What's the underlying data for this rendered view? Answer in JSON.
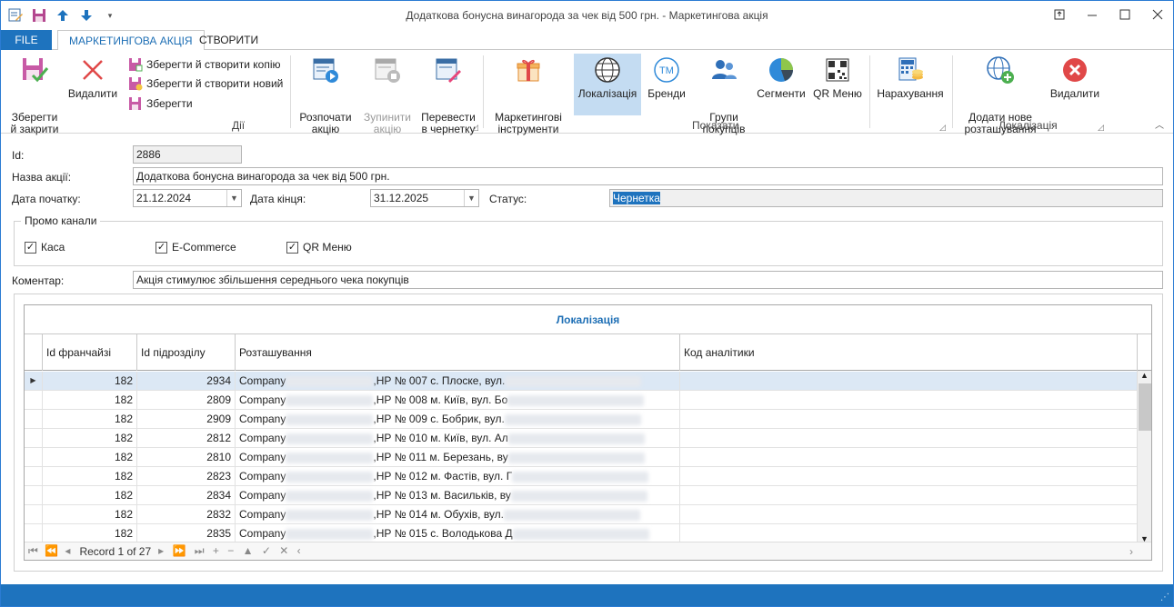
{
  "window": {
    "title": "Додаткова бонусна винагорода за чек від 500 грн. - Маркетингова акція",
    "controls": [
      "restore",
      "minimize",
      "maximize",
      "close"
    ]
  },
  "tabs": {
    "file": "FILE",
    "marketing": "МАРКЕТИНГОВА АКЦІЯ",
    "create": "СТВОРИТИ"
  },
  "ribbon": {
    "save_close": "Зберегти\nй закрити",
    "delete": "Видалити",
    "save_copy": "Зберегти й створити копію",
    "save_new": "Зберегти й створити новий",
    "save": "Зберегти",
    "start": "Розпочати\nакцію",
    "stop": "Зупинити\nакцію",
    "draft": "Перевести\nв чернетку",
    "group_actions": "Дії",
    "tools": "Маркетингові\nінструменти",
    "localization": "Локалізація",
    "brands": "Бренди",
    "purchase_groups": "Групи\nпокупців",
    "segments": "Сегменти",
    "qr_menu": "QR Меню",
    "accruals": "Нарахування",
    "group_show": "Показати",
    "add_location": "Додати нове\nрозташування",
    "delete_location": "Видалити",
    "group_localization": "Локалізація"
  },
  "form": {
    "id_label": "Id:",
    "id_value": "2886",
    "name_label": "Назва акції:",
    "name_value": "Додаткова бонусна винагорода за чек від 500 грн.",
    "start_label": "Дата початку:",
    "start_value": "21.12.2024",
    "end_label": "Дата кінця:",
    "end_value": "31.12.2025",
    "status_label": "Статус:",
    "status_value": "Чернетка",
    "channels_title": "Промо канали",
    "channels": [
      {
        "label": "Каса",
        "checked": true
      },
      {
        "label": "E-Commerce",
        "checked": true
      },
      {
        "label": "QR Меню",
        "checked": true
      }
    ],
    "comment_label": "Коментар:",
    "comment_value": "Акція стимулює збільшення середнього чека покупців"
  },
  "grid": {
    "caption": "Локалізація",
    "columns": [
      "Id франчайзі",
      "Id підрозділу",
      "Розташування",
      "Код аналітики"
    ],
    "rows": [
      {
        "franchise": "182",
        "unit": "2934",
        "loc_a": "Company",
        "loc_b": ",НР № 007 с. Плоске, вул."
      },
      {
        "franchise": "182",
        "unit": "2809",
        "loc_a": "Company",
        "loc_b": ",НР № 008 м. Київ, вул. Бо"
      },
      {
        "franchise": "182",
        "unit": "2909",
        "loc_a": "Company",
        "loc_b": ",НР № 009 с. Бобрик, вул."
      },
      {
        "franchise": "182",
        "unit": "2812",
        "loc_a": "Company",
        "loc_b": ",НР № 010 м. Київ, вул. Ал"
      },
      {
        "franchise": "182",
        "unit": "2810",
        "loc_a": "Company",
        "loc_b": ",НР № 011 м. Березань, ву"
      },
      {
        "franchise": "182",
        "unit": "2823",
        "loc_a": "Company",
        "loc_b": ",НР № 012 м. Фастів, вул. Г"
      },
      {
        "franchise": "182",
        "unit": "2834",
        "loc_a": "Company",
        "loc_b": ",НР № 013 м. Васильків, ву"
      },
      {
        "franchise": "182",
        "unit": "2832",
        "loc_a": "Company",
        "loc_b": ",НР № 014 м. Обухів, вул."
      },
      {
        "franchise": "182",
        "unit": "2835",
        "loc_a": "Company",
        "loc_b": ",НР № 015 с. Володькова Д"
      }
    ],
    "navigator": "Record 1 of 27"
  },
  "colors": {
    "accent": "#1e73be",
    "selected_tab_text": "#1e6fb5",
    "ribbon_selected": "#c4dcf2",
    "current_row": "#dce8f5"
  }
}
